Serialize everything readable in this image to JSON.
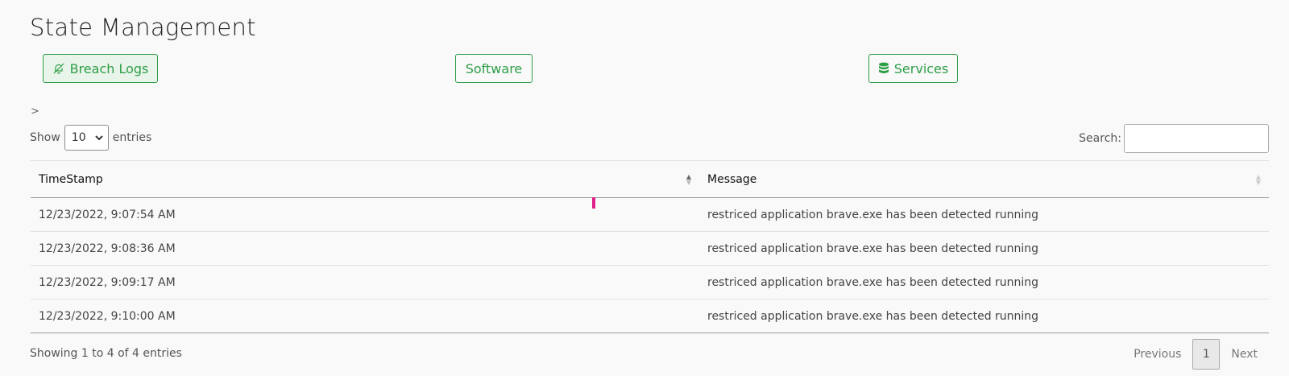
{
  "page": {
    "title": "State Management"
  },
  "tabs": [
    {
      "label": "Breach Logs",
      "icon": "bell-slash-icon",
      "active": true
    },
    {
      "label": "Software",
      "icon": "",
      "active": false
    },
    {
      "label": "Services",
      "icon": "database-icon",
      "active": false
    }
  ],
  "breadcrumb": {
    "chevron": ">"
  },
  "length_control": {
    "prefix": "Show",
    "selected": "10",
    "suffix": "entries"
  },
  "search": {
    "label": "Search:",
    "value": ""
  },
  "table": {
    "columns": [
      {
        "label": "TimeStamp",
        "sort": "asc"
      },
      {
        "label": "Message",
        "sort": "none"
      }
    ],
    "rows": [
      {
        "timestamp": "12/23/2022, 9:07:54 AM",
        "message": "restriced application brave.exe has been detected running"
      },
      {
        "timestamp": "12/23/2022, 9:08:36 AM",
        "message": "restriced application brave.exe has been detected running"
      },
      {
        "timestamp": "12/23/2022, 9:09:17 AM",
        "message": "restriced application brave.exe has been detected running"
      },
      {
        "timestamp": "12/23/2022, 9:10:00 AM",
        "message": "restriced application brave.exe has been detected running"
      }
    ]
  },
  "footer": {
    "info": "Showing 1 to 4 of 4 entries",
    "previous": "Previous",
    "current_page": "1",
    "next": "Next"
  },
  "colors": {
    "accent_green": "#2e9e47",
    "marker_pink": "#e0208a"
  }
}
